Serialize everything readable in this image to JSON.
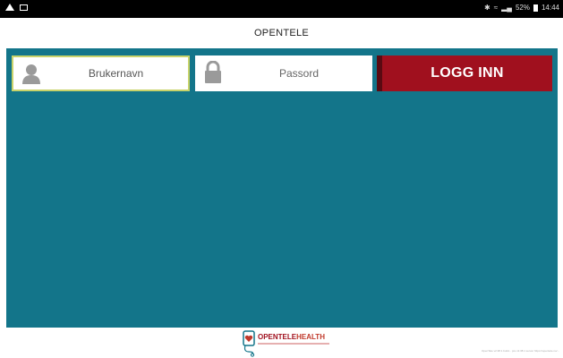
{
  "status_bar": {
    "icons": [
      "warning-icon",
      "image-icon",
      "bluetooth-icon",
      "wifi-icon",
      "signal-icon",
      "battery-icon"
    ],
    "battery_text": "52%",
    "time": "14:44"
  },
  "header": {
    "title": "OPENTELE"
  },
  "login_form": {
    "username": {
      "value": "Brukernavn",
      "placeholder": "Brukernavn"
    },
    "password": {
      "placeholder": "Passord"
    },
    "login_button_label": "LOGG INN"
  },
  "footer": {
    "logo": {
      "text_open": "OPEN",
      "text_tele": "TELE",
      "text_health": "HEALTH"
    },
    "version_text": "OpenTele v2.38.1 build... pre v2.38.1 server https://opentele.no/..."
  },
  "colors": {
    "background": "#13758a",
    "accent": "#a0101e",
    "focus_border": "#c9d36a"
  }
}
